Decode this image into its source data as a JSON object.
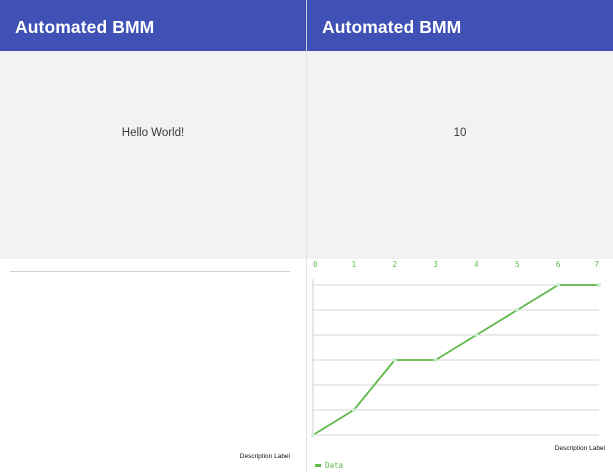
{
  "left_screen": {
    "app_title": "Automated BMM",
    "content_text": "Hello World!",
    "chart": {
      "description_label": "Description Label"
    }
  },
  "right_screen": {
    "app_title": "Automated BMM",
    "content_text": "10",
    "chart": {
      "description_label": "Description Label"
    }
  },
  "colors": {
    "app_bar": "#3f51b5",
    "line": "#5fb84a",
    "content_background": "#f2f2f2"
  },
  "chart_data": {
    "type": "line",
    "title": "",
    "xlabel": "",
    "ylabel": "",
    "x": [
      0,
      1,
      2,
      3,
      4,
      5,
      6,
      7
    ],
    "x_tick_labels": [
      "0",
      "1",
      "2",
      "3",
      "4",
      "5",
      "6",
      "7"
    ],
    "series": [
      {
        "name": "Data",
        "values": [
          0,
          1,
          3,
          3,
          4,
          5,
          6,
          6
        ]
      }
    ],
    "xlim": [
      0,
      7
    ],
    "ylim": [
      0,
      6
    ],
    "grid": true,
    "x_axis_position": "top",
    "legend_position": "bottom-left",
    "description": "Description Label"
  }
}
